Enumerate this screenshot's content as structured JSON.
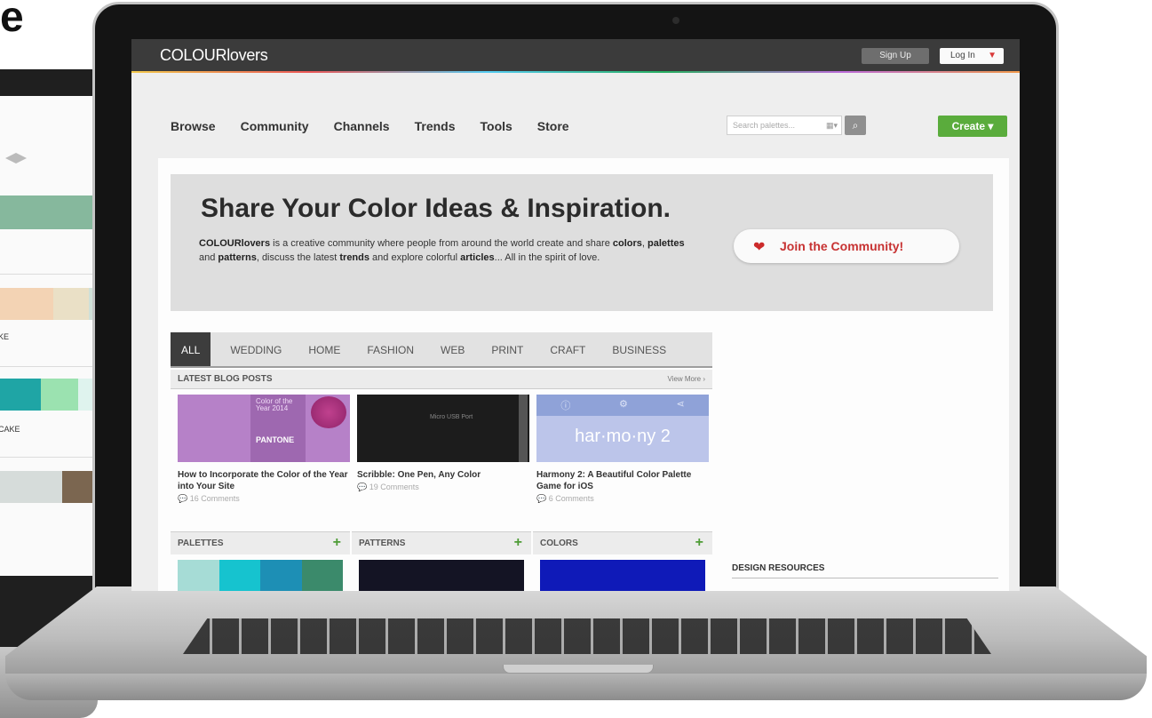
{
  "background_laptop": {
    "mark": "e",
    "labels": [
      "KE",
      "CAKE"
    ]
  },
  "header": {
    "logo": "COLOURlovers",
    "signup": "Sign Up",
    "login": "Log In",
    "login_caret": "▼"
  },
  "nav": {
    "items": [
      "Browse",
      "Community",
      "Channels",
      "Trends",
      "Tools",
      "Store"
    ]
  },
  "search": {
    "placeholder": "Search palettes...",
    "options_glyph": "▦▾",
    "button_glyph": "⌕"
  },
  "create_button": "Create ▾",
  "hero": {
    "title": "Share Your Color Ideas & Inspiration.",
    "brand": "COLOURlovers",
    "text_1": " is a creative community where people from around the world create and share ",
    "colors": "colors",
    "text_2": ", ",
    "palettes": "palettes",
    "text_3": " and ",
    "patterns": "patterns",
    "text_4": ", discuss the latest ",
    "trends": "trends",
    "text_5": " and explore colorful ",
    "articles": "articles",
    "text_6": "... All in the spirit of love.",
    "join_heart": "❤",
    "join_label": "Join the Community!"
  },
  "tabs": [
    "ALL",
    "WEDDING",
    "HOME",
    "FASHION",
    "WEB",
    "PRINT",
    "CRAFT",
    "BUSINESS"
  ],
  "blog": {
    "title": "LATEST BLOG POSTS",
    "view_more": "View More ›",
    "posts": [
      {
        "title": "How to Incorporate the Color of the Year into Your Site",
        "comments": "💬 16 Comments",
        "thumb_text": "Color of the Year 2014",
        "thumb_label": "PANTONE"
      },
      {
        "title": "Scribble: One Pen, Any Color",
        "comments": "💬 19 Comments",
        "thumb_text": "Micro USB Port"
      },
      {
        "title": "Harmony 2: A Beautiful Color Palette Game for iOS",
        "comments": "💬 6 Comments",
        "thumb_text": "har·mo·ny 2",
        "thumb_icons": [
          "ⓘ",
          "⚙",
          "⋖"
        ]
      }
    ]
  },
  "sections": [
    {
      "title": "PALETTES",
      "plus": "+",
      "colors": [
        "#a6dcd6",
        "#16c3cf",
        "#1d8fb5",
        "#3b8a6b"
      ]
    },
    {
      "title": "PATTERNS",
      "plus": "+",
      "colors": [
        "#141424"
      ]
    },
    {
      "title": "COLORS",
      "plus": "+",
      "colors": [
        "#0f1ab8"
      ]
    }
  ],
  "sidebar": {
    "design_resources": "DESIGN RESOURCES"
  },
  "colors": {
    "topbar": "#3b3b3b",
    "create_green": "#5aac3c",
    "join_red": "#c73232",
    "hero_bg": "#dedede"
  }
}
